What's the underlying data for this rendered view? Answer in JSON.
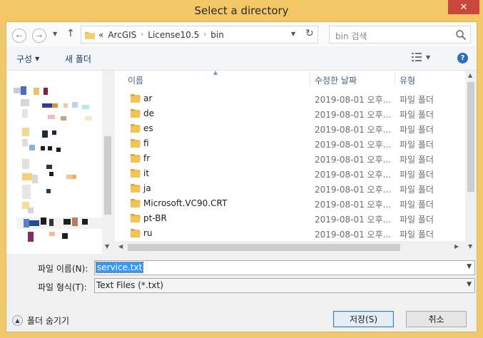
{
  "window": {
    "title": "Select a directory",
    "close_glyph": "✕"
  },
  "nav": {
    "back_glyph": "←",
    "forward_glyph": "→",
    "up_glyph": "↑",
    "address": {
      "prefix": "«",
      "crumbs": [
        "ArcGIS",
        "License10.5",
        "bin"
      ]
    },
    "search_placeholder": "bin 검색"
  },
  "toolbar": {
    "organize": "구성",
    "new_folder": "새 폴더",
    "help_glyph": "?"
  },
  "columns": {
    "name": "이름",
    "date": "수정한 날짜",
    "type": "유형"
  },
  "files": [
    {
      "name": "ar",
      "date": "2019-08-01 오후...",
      "type": "파일 폴더"
    },
    {
      "name": "de",
      "date": "2019-08-01 오후...",
      "type": "파일 폴더"
    },
    {
      "name": "es",
      "date": "2019-08-01 오후...",
      "type": "파일 폴더"
    },
    {
      "name": "fi",
      "date": "2019-08-01 오후...",
      "type": "파일 폴더"
    },
    {
      "name": "fr",
      "date": "2019-08-01 오후...",
      "type": "파일 폴더"
    },
    {
      "name": "it",
      "date": "2019-08-01 오후...",
      "type": "파일 폴더"
    },
    {
      "name": "ja",
      "date": "2019-08-01 오후...",
      "type": "파일 폴더"
    },
    {
      "name": "Microsoft.VC90.CRT",
      "date": "2019-08-01 오후...",
      "type": "파일 폴더"
    },
    {
      "name": "pt-BR",
      "date": "2019-08-01 오후...",
      "type": "파일 폴더"
    },
    {
      "name": "ru",
      "date": "2019-08-01 오후...",
      "type": "파일 폴더"
    }
  ],
  "form": {
    "filename_label": "파일 이름(N):",
    "filename_value": "service.txt",
    "filetype_label": "파일 형식(T):",
    "filetype_value": "Text Files (*.txt)"
  },
  "footer": {
    "hide_folders": "폴더 숨기기",
    "save": "저장(S)",
    "cancel": "취소"
  }
}
